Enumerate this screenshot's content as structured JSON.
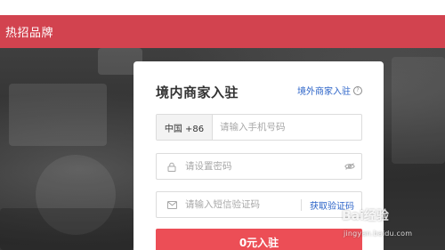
{
  "header": {
    "title": "热招品牌",
    "background_color": "#d2434f"
  },
  "form": {
    "title": "境内商家入驻",
    "overseas_link": "境外商家入驻",
    "help_icon": "question-circle-icon",
    "phone": {
      "country_code": "中国 +86",
      "placeholder": "请输入手机号码",
      "value": ""
    },
    "password": {
      "placeholder": "请设置密码",
      "value": "",
      "lock_icon": "lock-icon",
      "toggle_icon": "eye-off-icon"
    },
    "sms": {
      "placeholder": "请输入短信验证码",
      "value": "",
      "mail_icon": "envelope-icon",
      "get_code_label": "获取验证码"
    },
    "submit_label": "0元入驻",
    "submit_color": "#ec4e56",
    "link_color": "#2b63c8"
  },
  "watermark": {
    "brand": "Bai经验",
    "url": "jingyan.baidu.com"
  }
}
